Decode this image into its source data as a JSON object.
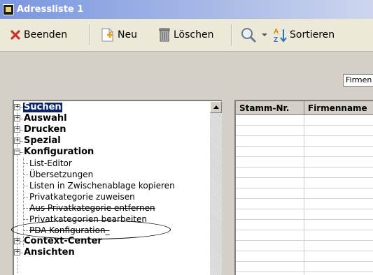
{
  "window": {
    "title": "Adressliste 1"
  },
  "toolbar": {
    "close_label": "Beenden",
    "new_label": "Neu",
    "delete_label": "Löschen",
    "sort_label": "Sortieren"
  },
  "filter": {
    "combo_value": "Firmen"
  },
  "tree": {
    "top_items": [
      {
        "label": "Suchen",
        "selected": true
      },
      {
        "label": "Auswahl"
      },
      {
        "label": "Drucken"
      },
      {
        "label": "Spezial"
      },
      {
        "label": "Konfiguration",
        "expanded": true
      }
    ],
    "config_children": [
      {
        "label": "List-Editor"
      },
      {
        "label": "Übersetzungen"
      },
      {
        "label": "Listen in Zwischenablage kopieren"
      },
      {
        "label": "Privatkategorie zuweisen"
      },
      {
        "label": "Aus Privatkategorie entfernen",
        "struck": true
      },
      {
        "label": "Privatkategorien bearbeiten",
        "circled": true
      },
      {
        "label": "PDA Konfiguration_",
        "struck": true
      }
    ],
    "bottom_items": [
      {
        "label": "Context-Center"
      },
      {
        "label": "Ansichten"
      }
    ]
  },
  "grid": {
    "columns": [
      "Stamm-Nr.",
      "Firmenname"
    ]
  }
}
